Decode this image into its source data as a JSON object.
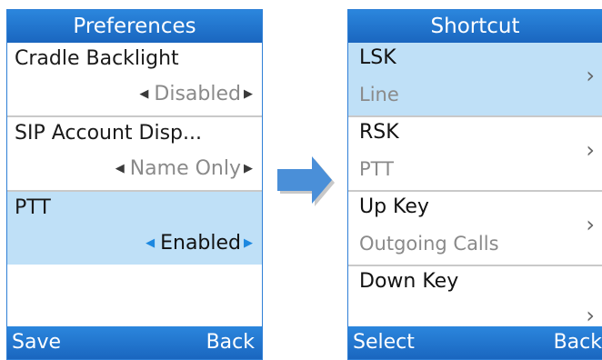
{
  "left_screen": {
    "title": "Preferences",
    "items": [
      {
        "label": "Cradle Backlight",
        "value": "Disabled"
      },
      {
        "label": "SIP Account Disp...",
        "value": "Name Only"
      },
      {
        "label": "PTT",
        "value": "Enabled"
      }
    ],
    "selected_index": 2,
    "softkeys": {
      "left": "Save",
      "right": "Back"
    },
    "arrow_left": "◀",
    "arrow_right": "▶"
  },
  "right_screen": {
    "title": "Shortcut",
    "items": [
      {
        "title": "LSK",
        "subtitle": "Line"
      },
      {
        "title": "RSK",
        "subtitle": "PTT"
      },
      {
        "title": "Up Key",
        "subtitle": "Outgoing Calls"
      },
      {
        "title": "Down Key",
        "subtitle": ""
      }
    ],
    "selected_index": 0,
    "chevron": "›",
    "softkeys": {
      "left": "Select",
      "right": "Back"
    }
  },
  "colors": {
    "title_bar": "#1f73cc",
    "selection": "#bfe0f7",
    "arrow_accent": "#1c88e0",
    "transition_arrow": "#4a8fd8"
  },
  "icons": {
    "left_value_arrow": "triangle-left-icon",
    "right_value_arrow": "triangle-right-icon",
    "item_chevron": "chevron-right-icon",
    "transition": "block-arrow-right-icon"
  }
}
